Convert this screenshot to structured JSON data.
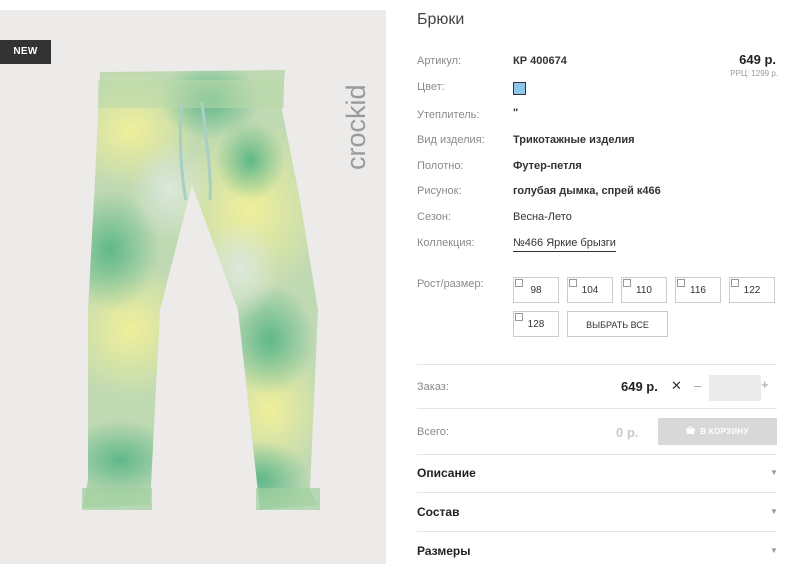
{
  "badge": "NEW",
  "brand": "crockid",
  "product": {
    "title": "Брюки",
    "price": "649 р.",
    "rrp": "РРЦ: 1299 р."
  },
  "props": [
    {
      "label": "Артикул:",
      "value": "КР 400674"
    },
    {
      "label": "Цвет:",
      "value": ""
    },
    {
      "label": "Утеплитель:",
      "value": "\""
    },
    {
      "label": "Вид изделия:",
      "value": "Трикотажные изделия"
    },
    {
      "label": "Полотно:",
      "value": "Футер-петля"
    },
    {
      "label": "Рисунок:",
      "value": "голубая дымка, спрей к466"
    },
    {
      "label": "Сезон:",
      "value": "Весна-Лето"
    },
    {
      "label": "Коллекция:",
      "value": "№466 Яркие брызги"
    }
  ],
  "colors": {
    "swatch": "#8ec5ea",
    "button_disabled": "#d8d8d8"
  },
  "sizes": {
    "label": "Рост/размер:",
    "options": [
      "98",
      "104",
      "110",
      "116",
      "122",
      "128"
    ],
    "select_all": "ВЫБРАТЬ ВСЕ"
  },
  "order": {
    "label": "Заказ:",
    "price": "649 р.",
    "times": "✕",
    "minus": "–",
    "plus": "+",
    "quantity": ""
  },
  "total": {
    "label": "Всего:",
    "value": "0 р.",
    "cart_button": "В КОРЗИНУ",
    "cart_icon": "basket-icon"
  },
  "accordion": [
    {
      "title": "Описание"
    },
    {
      "title": "Состав"
    },
    {
      "title": "Размеры"
    }
  ]
}
